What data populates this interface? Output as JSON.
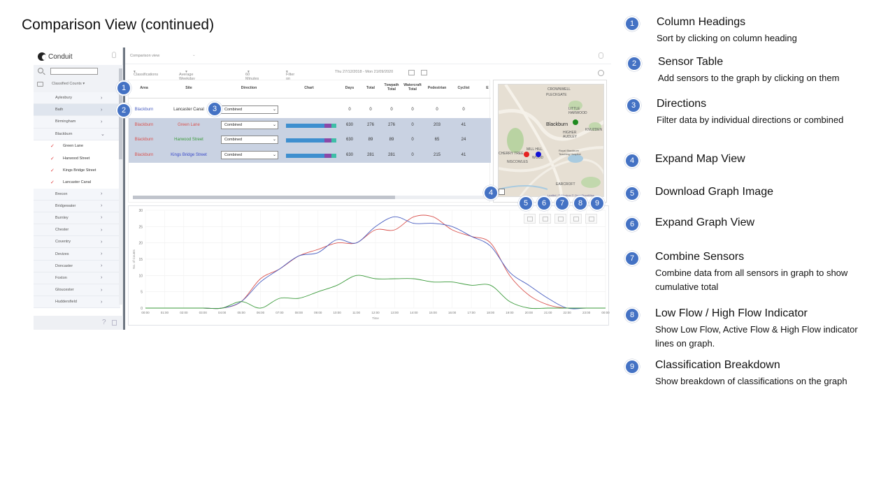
{
  "slide_title": "Comparison View (continued)",
  "app": {
    "brand": "Conduit",
    "view_select": "Comparison view",
    "sidebar": {
      "dropdown": "Classified Counts",
      "items": [
        {
          "label": "Aylesbury",
          "type": "group"
        },
        {
          "label": "Bath",
          "type": "group",
          "active": true
        },
        {
          "label": "Birmingham",
          "type": "group"
        },
        {
          "label": "Blackburn",
          "type": "group-open"
        },
        {
          "label": "Green Lane",
          "type": "sub"
        },
        {
          "label": "Harwood Street",
          "type": "sub"
        },
        {
          "label": "Kings Bridge Street",
          "type": "sub"
        },
        {
          "label": "Lancaster Canal",
          "type": "sub"
        },
        {
          "label": "Brecon",
          "type": "group"
        },
        {
          "label": "Bridgewater",
          "type": "group"
        },
        {
          "label": "Burnley",
          "type": "group"
        },
        {
          "label": "Chester",
          "type": "group"
        },
        {
          "label": "Coventry",
          "type": "group"
        },
        {
          "label": "Devizes",
          "type": "group"
        },
        {
          "label": "Doncaster",
          "type": "group"
        },
        {
          "label": "Foxton",
          "type": "group"
        },
        {
          "label": "Gloucester",
          "type": "group"
        },
        {
          "label": "Huddersfield",
          "type": "group"
        }
      ]
    },
    "filters": {
      "classifications": "Classifications",
      "average": "Average Weekday",
      "interval": "60 Minutes",
      "site_type": "Filter on site type",
      "date_range": "Thu 27/12/2018 - Mon 21/09/2020"
    },
    "table": {
      "headers": [
        "Area",
        "Site",
        "Direction",
        "Chart",
        "Days",
        "Total",
        "Towpath Total",
        "Watercraft Total",
        "Pedestrian",
        "Cyclist",
        "E"
      ],
      "rows": [
        {
          "area": "Blackburn",
          "site": "Lancaster Canal",
          "direction": "Combined",
          "days": "0",
          "total": "0",
          "towpath": "0",
          "watercraft": "0",
          "pedestrian": "0",
          "cyclist": "0",
          "selected": false,
          "area_color": "#4a5fc1",
          "site_color": "#333333"
        },
        {
          "area": "Blackburn",
          "site": "Green Lane",
          "direction": "Combined",
          "days": "630",
          "total": "276",
          "towpath": "276",
          "watercraft": "0",
          "pedestrian": "203",
          "cyclist": "41",
          "selected": true,
          "area_color": "#d9534f",
          "site_color": "#d9534f"
        },
        {
          "area": "Blackburn",
          "site": "Harwood Street",
          "direction": "Combined",
          "days": "630",
          "total": "89",
          "towpath": "89",
          "watercraft": "0",
          "pedestrian": "65",
          "cyclist": "24",
          "selected": true,
          "area_color": "#d9534f",
          "site_color": "#3a9a3a"
        },
        {
          "area": "Blackburn",
          "site": "Kings Bridge Street",
          "direction": "Combined",
          "days": "630",
          "total": "281",
          "towpath": "281",
          "watercraft": "0",
          "pedestrian": "215",
          "cyclist": "41",
          "selected": true,
          "area_color": "#d9534f",
          "site_color": "#3949c9"
        }
      ]
    },
    "map": {
      "labels": [
        "CROWNWELL",
        "PLECKGATE",
        "LITTLE HARWOOD",
        "Blackburn",
        "HIGHER AUDLEY",
        "KNUZDEN",
        "CHERRY TREE",
        "MILL HILL",
        "WOOD",
        "Royal Blackburn Teaching Hospital",
        "NISCOWLES",
        "EARCROFT"
      ],
      "attribution": "Leaflet | © Mapbox © OpenStreetMap"
    },
    "graph": {
      "ylabel": "No. of Counts",
      "xlabel": "Time"
    }
  },
  "chart_data": {
    "type": "line",
    "x": [
      "00:00",
      "01:00",
      "02:00",
      "03:00",
      "04:00",
      "05:00",
      "06:00",
      "07:00",
      "08:00",
      "09:00",
      "10:00",
      "11:00",
      "12:00",
      "13:00",
      "14:00",
      "15:00",
      "16:00",
      "17:00",
      "18:00",
      "19:00",
      "20:00",
      "21:00",
      "22:00",
      "23:00",
      "00:00"
    ],
    "yticks": [
      0,
      5,
      10,
      15,
      20,
      25,
      30
    ],
    "ylim": [
      0,
      30
    ],
    "ylabel": "No. of Counts",
    "xlabel": "Time",
    "series": [
      {
        "name": "",
        "color": "#d9534f",
        "values": [
          0,
          0,
          0,
          0,
          0,
          2,
          9,
          12,
          16,
          18,
          20,
          20,
          24,
          24,
          28,
          28,
          24,
          22,
          20,
          10,
          4,
          1,
          0,
          0,
          0
        ]
      },
      {
        "name": "",
        "color": "#4a5fc1",
        "values": [
          0,
          0,
          0,
          0,
          0,
          2,
          8,
          12,
          16,
          17,
          21,
          20,
          25,
          28,
          26,
          26,
          25,
          22,
          19,
          11,
          7,
          3,
          0,
          0,
          0
        ]
      },
      {
        "name": "",
        "color": "#3a9a3a",
        "values": [
          0,
          0,
          0,
          0,
          0,
          2,
          0,
          3,
          3,
          5,
          7,
          10,
          9,
          9,
          9,
          8,
          8,
          7,
          7,
          2,
          0,
          0,
          0,
          0,
          0
        ]
      }
    ]
  },
  "callouts": [
    {
      "n": "1",
      "title": "Column Headings",
      "desc": "Sort by clicking on column heading"
    },
    {
      "n": "2",
      "title": "Sensor Table",
      "desc": "Add sensors to the graph by clicking on them"
    },
    {
      "n": "3",
      "title": "Directions",
      "desc": "Filter data by individual directions or combined"
    },
    {
      "n": "4",
      "title": "Expand Map View",
      "desc": ""
    },
    {
      "n": "5",
      "title": "Download Graph Image",
      "desc": ""
    },
    {
      "n": "6",
      "title": "Expand Graph View",
      "desc": ""
    },
    {
      "n": "7",
      "title": "Combine Sensors",
      "desc": "Combine data from all sensors in graph to show cumulative total"
    },
    {
      "n": "8",
      "title": "Low Flow / High Flow Indicator",
      "desc": "Show Low Flow, Active Flow & High Flow indicator lines on graph."
    },
    {
      "n": "9",
      "title": "Classification Breakdown",
      "desc": "Show breakdown of classifications on the graph"
    }
  ]
}
